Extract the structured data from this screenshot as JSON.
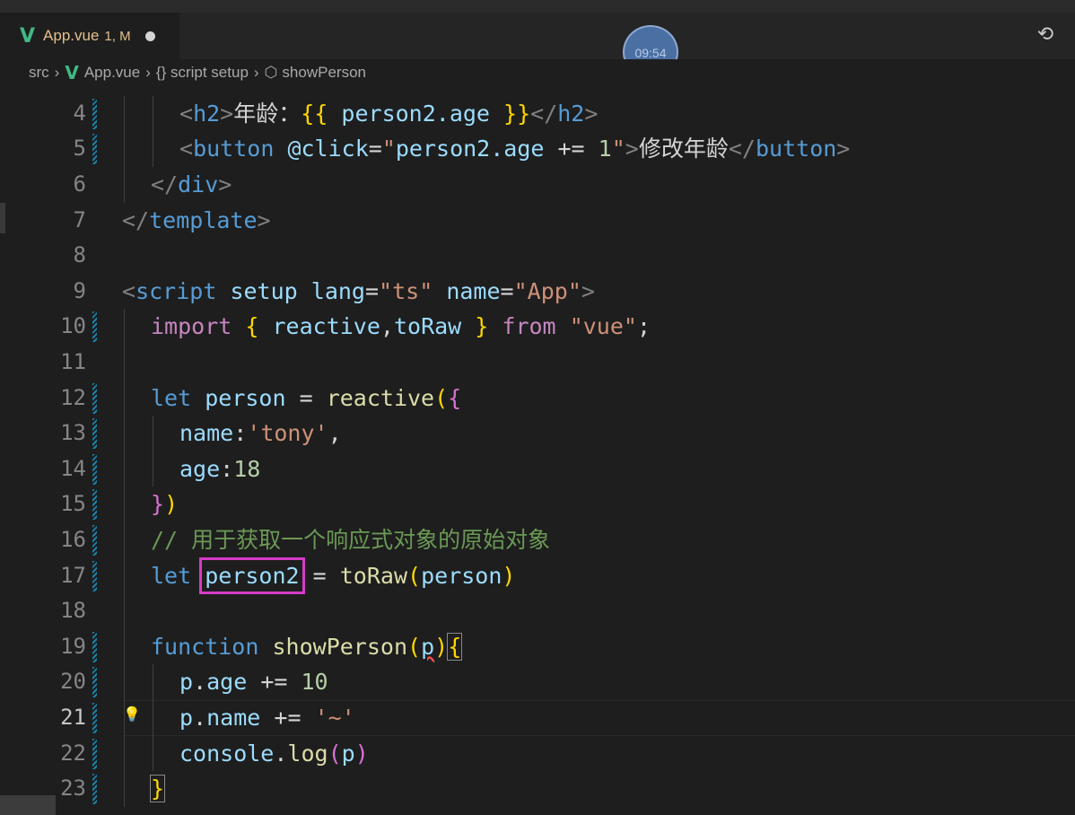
{
  "tab": {
    "name": "App.vue",
    "status": "1, M",
    "logo": "V"
  },
  "clock": {
    "time": "09:54"
  },
  "breadcrumb": {
    "root": "src",
    "file": "App.vue",
    "block": "{} script setup",
    "symbol": "showPerson"
  },
  "lines": [
    {
      "n": "4",
      "html": "<span class=\"tag\">&lt;</span><span class=\"tn\">h2</span><span class=\"tag\">&gt;</span><span class=\"txt\">年龄：</span><span class=\"b1\">{{</span><span class=\"var\"> person2.age </span><span class=\"b1\">}}</span><span class=\"tag\">&lt;/</span><span class=\"tn\">h2</span><span class=\"tag\">&gt;</span>",
      "indent": 2
    },
    {
      "n": "5",
      "html": "<span class=\"tag\">&lt;</span><span class=\"tn\">button</span> <span class=\"at\">@click</span><span class=\"txt\">=</span><span class=\"str\">\"</span><span class=\"var\">person2.age</span><span class=\"txt\"> += </span><span class=\"num\">1</span><span class=\"str\">\"</span><span class=\"tag\">&gt;</span><span class=\"txt\">修改年龄</span><span class=\"tag\">&lt;/</span><span class=\"tn\">button</span><span class=\"tag\">&gt;</span>",
      "indent": 2
    },
    {
      "n": "6",
      "html": "<span class=\"tag\">&lt;/</span><span class=\"tn\">div</span><span class=\"tag\">&gt;</span>",
      "indent": 1
    },
    {
      "n": "7",
      "html": "<span class=\"tag\">&lt;/</span><span class=\"tn\">template</span><span class=\"tag\">&gt;</span>",
      "indent": 0
    },
    {
      "n": "8",
      "html": "",
      "indent": 0
    },
    {
      "n": "9",
      "html": "<span class=\"tag\">&lt;</span><span class=\"tn\">script</span> <span class=\"at\">setup</span> <span class=\"at\">lang</span><span class=\"txt\">=</span><span class=\"str\">\"ts\"</span> <span class=\"at\">name</span><span class=\"txt\">=</span><span class=\"str\">\"App\"</span><span class=\"tag\">&gt;</span>",
      "indent": 0
    },
    {
      "n": "10",
      "html": "<span class=\"kw2\">import</span> <span class=\"b1\">{</span><span class=\"var\"> reactive</span><span class=\"txt\">,</span><span class=\"var\">toRaw </span><span class=\"b1\">}</span> <span class=\"kw2\">from</span> <span class=\"str\">\"vue\"</span><span class=\"txt\">;</span>",
      "indent": 1
    },
    {
      "n": "11",
      "html": "",
      "indent": 1
    },
    {
      "n": "12",
      "html": "<span class=\"kw\">let</span> <span class=\"var\">person</span><span class=\"txt\"> = </span><span class=\"fn\">reactive</span><span class=\"b1\">(</span><span class=\"b2\">{</span>",
      "indent": 1
    },
    {
      "n": "13",
      "html": "<span class=\"var\">name</span><span class=\"txt\">:</span><span class=\"str\">'tony'</span><span class=\"txt\">,</span>",
      "indent": 2
    },
    {
      "n": "14",
      "html": "<span class=\"var\">age</span><span class=\"txt\">:</span><span class=\"num\">18</span>",
      "indent": 2
    },
    {
      "n": "15",
      "html": "<span class=\"b2\">}</span><span class=\"b1\">)</span>",
      "indent": 1
    },
    {
      "n": "16",
      "html": "<span class=\"cmt\">// 用于获取一个响应式对象的原始对象</span>",
      "indent": 1
    },
    {
      "n": "17",
      "html": "<span class=\"kw\">let</span> <span class=\"var highlight\">person2</span><span class=\"txt\"> = </span><span class=\"fn\">toRaw</span><span class=\"b1\">(</span><span class=\"var\">person</span><span class=\"b1\">)</span>",
      "indent": 1
    },
    {
      "n": "18",
      "html": "",
      "indent": 1
    },
    {
      "n": "19",
      "html": "<span class=\"kw\">function</span> <span class=\"fn\">showPerson</span><span class=\"b1\">(</span><span class=\"var squiggle\">p</span><span class=\"b1\">)</span><span class=\"b1 box-cur\">{</span>",
      "indent": 1
    },
    {
      "n": "20",
      "html": "<span class=\"var\">p</span><span class=\"txt\">.</span><span class=\"var\">age</span><span class=\"txt\"> += </span><span class=\"num\">10</span>",
      "indent": 2
    },
    {
      "n": "21",
      "html": "<span class=\"var\">p</span><span class=\"txt\">.</span><span class=\"var\">name</span><span class=\"txt\"> += </span><span class=\"str\">'~'</span>",
      "indent": 2,
      "current": true
    },
    {
      "n": "22",
      "html": "<span class=\"var\">console</span><span class=\"txt\">.</span><span class=\"fn\">log</span><span class=\"b2\">(</span><span class=\"var\">p</span><span class=\"b2\">)</span>",
      "indent": 2
    },
    {
      "n": "23",
      "html": "<span class=\"b1 box-cur\">}</span>",
      "indent": 1
    }
  ],
  "modified_lines": [
    "4",
    "5",
    "10",
    "12",
    "13",
    "14",
    "15",
    "16",
    "17",
    "19",
    "20",
    "21",
    "22",
    "23"
  ]
}
